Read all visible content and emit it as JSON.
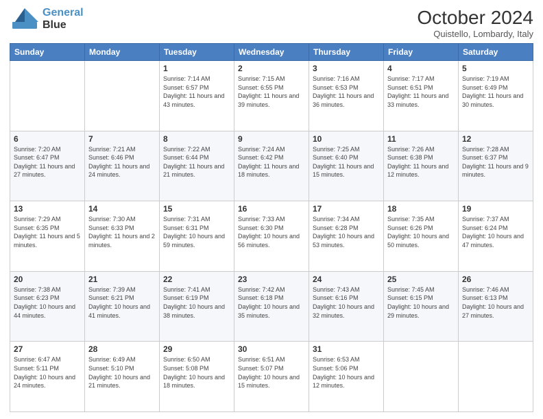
{
  "header": {
    "logo": {
      "line1": "General",
      "line2": "Blue"
    },
    "title": "October 2024",
    "location": "Quistello, Lombardy, Italy"
  },
  "weekdays": [
    "Sunday",
    "Monday",
    "Tuesday",
    "Wednesday",
    "Thursday",
    "Friday",
    "Saturday"
  ],
  "weeks": [
    [
      {
        "day": "",
        "sunrise": "",
        "sunset": "",
        "daylight": ""
      },
      {
        "day": "",
        "sunrise": "",
        "sunset": "",
        "daylight": ""
      },
      {
        "day": "1",
        "sunrise": "Sunrise: 7:14 AM",
        "sunset": "Sunset: 6:57 PM",
        "daylight": "Daylight: 11 hours and 43 minutes."
      },
      {
        "day": "2",
        "sunrise": "Sunrise: 7:15 AM",
        "sunset": "Sunset: 6:55 PM",
        "daylight": "Daylight: 11 hours and 39 minutes."
      },
      {
        "day": "3",
        "sunrise": "Sunrise: 7:16 AM",
        "sunset": "Sunset: 6:53 PM",
        "daylight": "Daylight: 11 hours and 36 minutes."
      },
      {
        "day": "4",
        "sunrise": "Sunrise: 7:17 AM",
        "sunset": "Sunset: 6:51 PM",
        "daylight": "Daylight: 11 hours and 33 minutes."
      },
      {
        "day": "5",
        "sunrise": "Sunrise: 7:19 AM",
        "sunset": "Sunset: 6:49 PM",
        "daylight": "Daylight: 11 hours and 30 minutes."
      }
    ],
    [
      {
        "day": "6",
        "sunrise": "Sunrise: 7:20 AM",
        "sunset": "Sunset: 6:47 PM",
        "daylight": "Daylight: 11 hours and 27 minutes."
      },
      {
        "day": "7",
        "sunrise": "Sunrise: 7:21 AM",
        "sunset": "Sunset: 6:46 PM",
        "daylight": "Daylight: 11 hours and 24 minutes."
      },
      {
        "day": "8",
        "sunrise": "Sunrise: 7:22 AM",
        "sunset": "Sunset: 6:44 PM",
        "daylight": "Daylight: 11 hours and 21 minutes."
      },
      {
        "day": "9",
        "sunrise": "Sunrise: 7:24 AM",
        "sunset": "Sunset: 6:42 PM",
        "daylight": "Daylight: 11 hours and 18 minutes."
      },
      {
        "day": "10",
        "sunrise": "Sunrise: 7:25 AM",
        "sunset": "Sunset: 6:40 PM",
        "daylight": "Daylight: 11 hours and 15 minutes."
      },
      {
        "day": "11",
        "sunrise": "Sunrise: 7:26 AM",
        "sunset": "Sunset: 6:38 PM",
        "daylight": "Daylight: 11 hours and 12 minutes."
      },
      {
        "day": "12",
        "sunrise": "Sunrise: 7:28 AM",
        "sunset": "Sunset: 6:37 PM",
        "daylight": "Daylight: 11 hours and 9 minutes."
      }
    ],
    [
      {
        "day": "13",
        "sunrise": "Sunrise: 7:29 AM",
        "sunset": "Sunset: 6:35 PM",
        "daylight": "Daylight: 11 hours and 5 minutes."
      },
      {
        "day": "14",
        "sunrise": "Sunrise: 7:30 AM",
        "sunset": "Sunset: 6:33 PM",
        "daylight": "Daylight: 11 hours and 2 minutes."
      },
      {
        "day": "15",
        "sunrise": "Sunrise: 7:31 AM",
        "sunset": "Sunset: 6:31 PM",
        "daylight": "Daylight: 10 hours and 59 minutes."
      },
      {
        "day": "16",
        "sunrise": "Sunrise: 7:33 AM",
        "sunset": "Sunset: 6:30 PM",
        "daylight": "Daylight: 10 hours and 56 minutes."
      },
      {
        "day": "17",
        "sunrise": "Sunrise: 7:34 AM",
        "sunset": "Sunset: 6:28 PM",
        "daylight": "Daylight: 10 hours and 53 minutes."
      },
      {
        "day": "18",
        "sunrise": "Sunrise: 7:35 AM",
        "sunset": "Sunset: 6:26 PM",
        "daylight": "Daylight: 10 hours and 50 minutes."
      },
      {
        "day": "19",
        "sunrise": "Sunrise: 7:37 AM",
        "sunset": "Sunset: 6:24 PM",
        "daylight": "Daylight: 10 hours and 47 minutes."
      }
    ],
    [
      {
        "day": "20",
        "sunrise": "Sunrise: 7:38 AM",
        "sunset": "Sunset: 6:23 PM",
        "daylight": "Daylight: 10 hours and 44 minutes."
      },
      {
        "day": "21",
        "sunrise": "Sunrise: 7:39 AM",
        "sunset": "Sunset: 6:21 PM",
        "daylight": "Daylight: 10 hours and 41 minutes."
      },
      {
        "day": "22",
        "sunrise": "Sunrise: 7:41 AM",
        "sunset": "Sunset: 6:19 PM",
        "daylight": "Daylight: 10 hours and 38 minutes."
      },
      {
        "day": "23",
        "sunrise": "Sunrise: 7:42 AM",
        "sunset": "Sunset: 6:18 PM",
        "daylight": "Daylight: 10 hours and 35 minutes."
      },
      {
        "day": "24",
        "sunrise": "Sunrise: 7:43 AM",
        "sunset": "Sunset: 6:16 PM",
        "daylight": "Daylight: 10 hours and 32 minutes."
      },
      {
        "day": "25",
        "sunrise": "Sunrise: 7:45 AM",
        "sunset": "Sunset: 6:15 PM",
        "daylight": "Daylight: 10 hours and 29 minutes."
      },
      {
        "day": "26",
        "sunrise": "Sunrise: 7:46 AM",
        "sunset": "Sunset: 6:13 PM",
        "daylight": "Daylight: 10 hours and 27 minutes."
      }
    ],
    [
      {
        "day": "27",
        "sunrise": "Sunrise: 6:47 AM",
        "sunset": "Sunset: 5:11 PM",
        "daylight": "Daylight: 10 hours and 24 minutes."
      },
      {
        "day": "28",
        "sunrise": "Sunrise: 6:49 AM",
        "sunset": "Sunset: 5:10 PM",
        "daylight": "Daylight: 10 hours and 21 minutes."
      },
      {
        "day": "29",
        "sunrise": "Sunrise: 6:50 AM",
        "sunset": "Sunset: 5:08 PM",
        "daylight": "Daylight: 10 hours and 18 minutes."
      },
      {
        "day": "30",
        "sunrise": "Sunrise: 6:51 AM",
        "sunset": "Sunset: 5:07 PM",
        "daylight": "Daylight: 10 hours and 15 minutes."
      },
      {
        "day": "31",
        "sunrise": "Sunrise: 6:53 AM",
        "sunset": "Sunset: 5:06 PM",
        "daylight": "Daylight: 10 hours and 12 minutes."
      },
      {
        "day": "",
        "sunrise": "",
        "sunset": "",
        "daylight": ""
      },
      {
        "day": "",
        "sunrise": "",
        "sunset": "",
        "daylight": ""
      }
    ]
  ]
}
